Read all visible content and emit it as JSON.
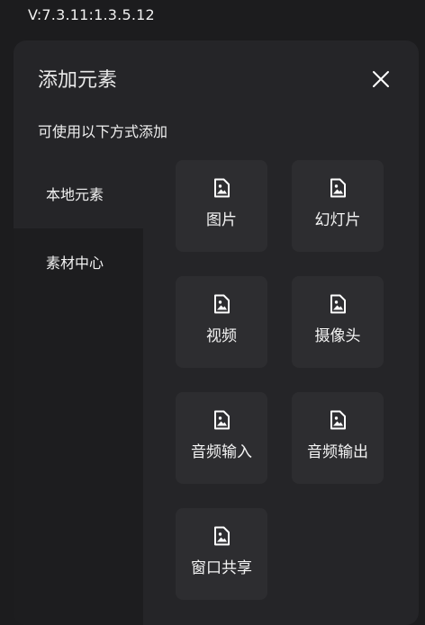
{
  "version": "V:7.3.11:1.3.5.12",
  "panel": {
    "title": "添加元素",
    "close_icon": "close-icon",
    "subtitle": "可使用以下方式添加"
  },
  "nav": {
    "items": [
      {
        "label": "本地元素",
        "active": true
      },
      {
        "label": "素材中心",
        "active": false
      }
    ]
  },
  "elements": {
    "icon": "image-file-icon",
    "items": [
      {
        "label": "图片"
      },
      {
        "label": "幻灯片"
      },
      {
        "label": "视频"
      },
      {
        "label": "摄像头"
      },
      {
        "label": "音频输入"
      },
      {
        "label": "音频输出"
      },
      {
        "label": "窗口共享"
      }
    ]
  },
  "colors": {
    "background": "#1c1c1e",
    "panel": "#252528",
    "tile": "#2d2d30",
    "nav_inactive": "#1d1d1f",
    "text": "#ffffff"
  }
}
